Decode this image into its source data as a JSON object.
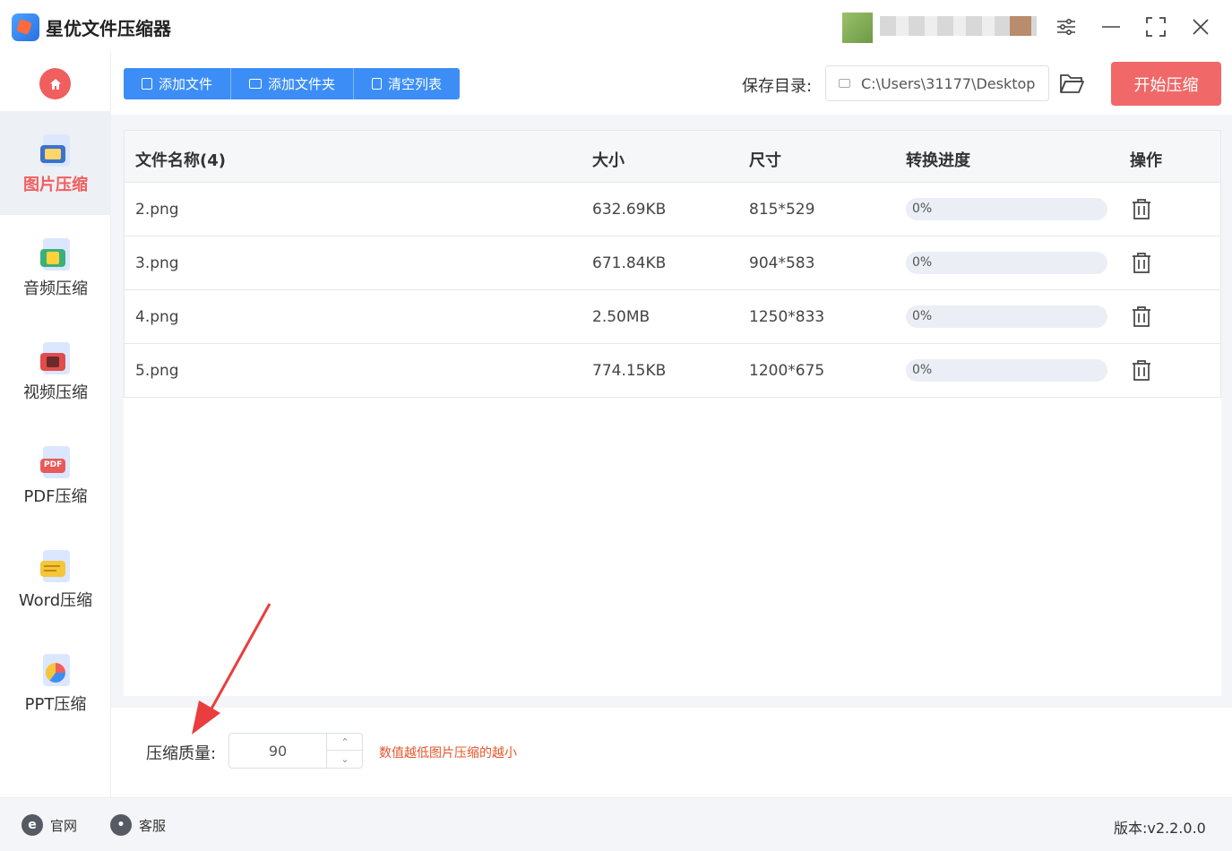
{
  "app": {
    "title": "星优文件压缩器"
  },
  "sidebar": {
    "items": [
      {
        "label": "图片压缩",
        "icon": "image-icon",
        "active": true
      },
      {
        "label": "音频压缩",
        "icon": "music-icon",
        "active": false
      },
      {
        "label": "视频压缩",
        "icon": "video-icon",
        "active": false
      },
      {
        "label": "PDF压缩",
        "icon": "pdf-icon",
        "active": false
      },
      {
        "label": "Word压缩",
        "icon": "word-icon",
        "active": false
      },
      {
        "label": "PPT压缩",
        "icon": "ppt-icon",
        "active": false
      }
    ]
  },
  "toolbar": {
    "add_file": "添加文件",
    "add_folder": "添加文件夹",
    "clear_list": "清空列表",
    "save_dir_label": "保存目录:",
    "save_dir_value": "C:\\Users\\31177\\Desktop",
    "start": "开始压缩"
  },
  "table": {
    "headers": {
      "name": "文件名称(4)",
      "size": "大小",
      "dims": "尺寸",
      "progress": "转换进度",
      "action": "操作"
    },
    "rows": [
      {
        "name": "2.png",
        "size": "632.69KB",
        "dims": "815*529",
        "progress_text": "0%",
        "progress": 0
      },
      {
        "name": "3.png",
        "size": "671.84KB",
        "dims": "904*583",
        "progress_text": "0%",
        "progress": 0
      },
      {
        "name": "4.png",
        "size": "2.50MB",
        "dims": "1250*833",
        "progress_text": "0%",
        "progress": 0
      },
      {
        "name": "5.png",
        "size": "774.15KB",
        "dims": "1200*675",
        "progress_text": "0%",
        "progress": 0
      }
    ]
  },
  "quality": {
    "label": "压缩质量:",
    "value": "90",
    "hint": "数值越低图片压缩的越小"
  },
  "footer": {
    "website": "官网",
    "support": "客服",
    "version": "版本:v2.2.0.0"
  },
  "colors": {
    "accent": "#3c8ef6",
    "danger": "#f06868",
    "hint": "#e6552a"
  }
}
